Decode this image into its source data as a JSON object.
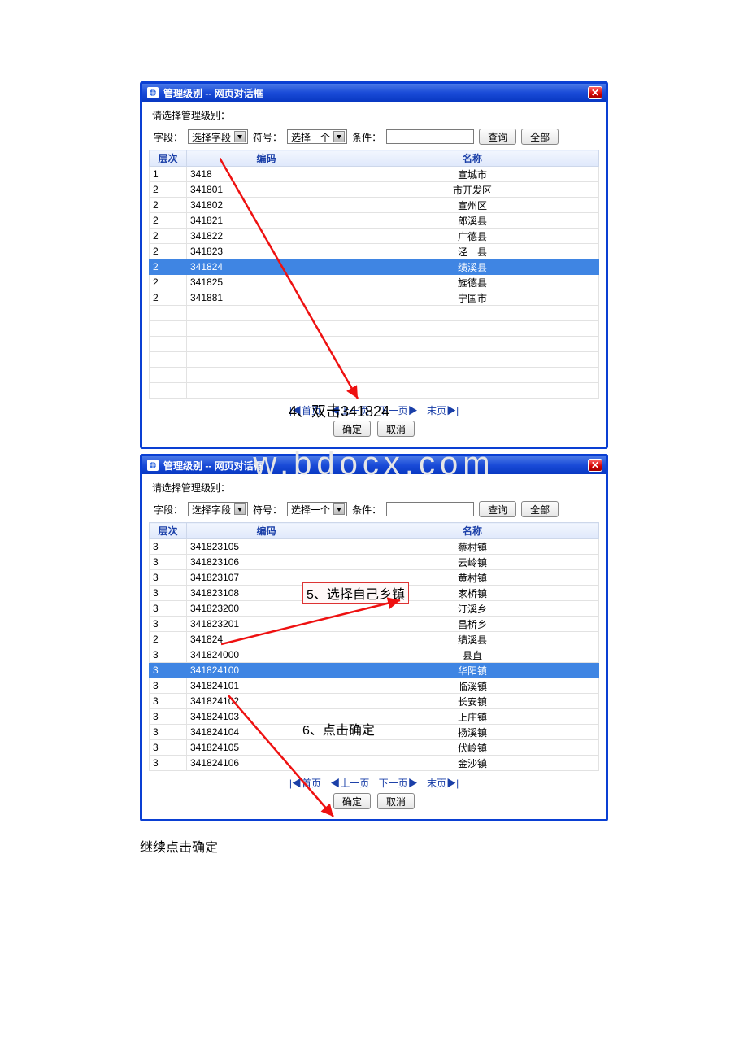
{
  "dialog_title": "管理级别  --  网页对话框",
  "prompt": "请选择管理级别：",
  "labels": {
    "field": "字段：",
    "select_field": "选择字段",
    "symbol": "符号：",
    "select_one": "选择一个",
    "condition": "条件：",
    "query": "查询",
    "all": "全部",
    "ok": "确定",
    "cancel": "取消",
    "first": "首页",
    "prev": "上一页",
    "next": "下一页",
    "last": "末页"
  },
  "columns": {
    "level": "层次",
    "code": "编码",
    "name": "名称"
  },
  "table1": {
    "rows": [
      {
        "level": "1",
        "code": "3418",
        "name": "宣城市",
        "selected": false
      },
      {
        "level": "2",
        "code": "341801",
        "name": "市开发区",
        "selected": false
      },
      {
        "level": "2",
        "code": "341802",
        "name": "宣州区",
        "selected": false
      },
      {
        "level": "2",
        "code": "341821",
        "name": "郎溪县",
        "selected": false
      },
      {
        "level": "2",
        "code": "341822",
        "name": "广德县",
        "selected": false
      },
      {
        "level": "2",
        "code": "341823",
        "name": "泾　县",
        "selected": false
      },
      {
        "level": "2",
        "code": "341824",
        "name": "绩溪县",
        "selected": true
      },
      {
        "level": "2",
        "code": "341825",
        "name": "旌德县",
        "selected": false
      },
      {
        "level": "2",
        "code": "341881",
        "name": "宁国市",
        "selected": false
      }
    ],
    "blank_rows": 6
  },
  "table2": {
    "rows": [
      {
        "level": "3",
        "code": "341823105",
        "name": "蔡村镇",
        "selected": false
      },
      {
        "level": "3",
        "code": "341823106",
        "name": "云岭镇",
        "selected": false
      },
      {
        "level": "3",
        "code": "341823107",
        "name": "黄村镇",
        "selected": false
      },
      {
        "level": "3",
        "code": "341823108",
        "name": "家桥镇",
        "selected": false
      },
      {
        "level": "3",
        "code": "341823200",
        "name": "汀溪乡",
        "selected": false
      },
      {
        "level": "3",
        "code": "341823201",
        "name": "昌桥乡",
        "selected": false
      },
      {
        "level": "2",
        "code": "341824",
        "name": "绩溪县",
        "selected": false
      },
      {
        "level": "3",
        "code": "341824000",
        "name": "县直",
        "selected": false
      },
      {
        "level": "3",
        "code": "341824100",
        "name": "华阳镇",
        "selected": true
      },
      {
        "level": "3",
        "code": "341824101",
        "name": "临溪镇",
        "selected": false
      },
      {
        "level": "3",
        "code": "341824102",
        "name": "长安镇",
        "selected": false
      },
      {
        "level": "3",
        "code": "341824103",
        "name": "上庄镇",
        "selected": false
      },
      {
        "level": "3",
        "code": "341824104",
        "name": "扬溪镇",
        "selected": false
      },
      {
        "level": "3",
        "code": "341824105",
        "name": "伏岭镇",
        "selected": false
      },
      {
        "level": "3",
        "code": "341824106",
        "name": "金沙镇",
        "selected": false
      }
    ],
    "blank_rows": 0
  },
  "annotations": {
    "a4": "4、双击341824",
    "a5": "5、选择自己乡镇",
    "a6": "6、点击确定"
  },
  "watermark": "w.bdocx.com",
  "follow_text": "继续点击确定"
}
